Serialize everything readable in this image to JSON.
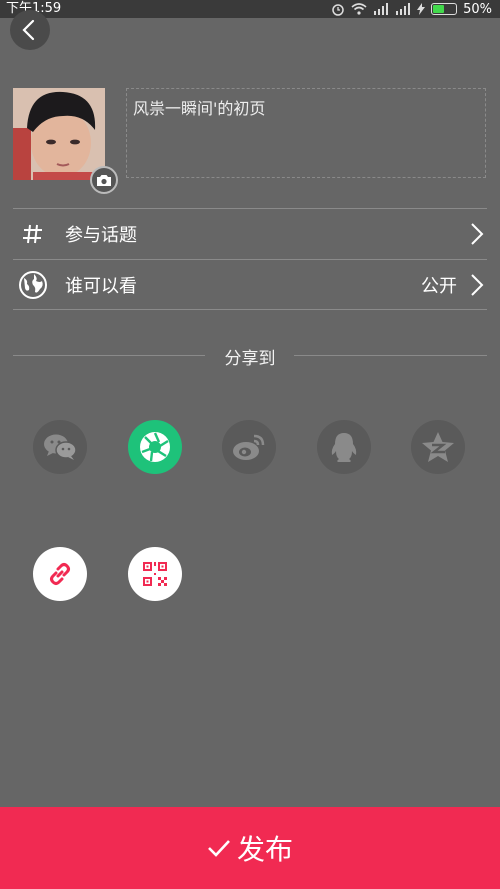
{
  "status_bar": {
    "time": "下午1:59",
    "battery": "50%",
    "battery_level": 0.5
  },
  "post": {
    "description": "风祟一瞬间'的初页"
  },
  "settings": {
    "topic_label": "参与话题",
    "visibility_label": "谁可以看",
    "visibility_value": "公开"
  },
  "share": {
    "title": "分享到",
    "targets": [
      "wechat",
      "wechat-moments",
      "weibo",
      "qq",
      "qzone",
      "copy-link",
      "qr-code"
    ]
  },
  "publish": {
    "label": "发布"
  },
  "colors": {
    "accent": "#f12a52",
    "moments_green": "#1ec27a",
    "background": "#666666"
  }
}
